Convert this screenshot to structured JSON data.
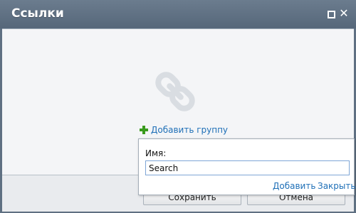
{
  "window": {
    "title": "Ссылки",
    "maximize_icon": "maximize-icon",
    "close_icon": "close-icon"
  },
  "main": {
    "empty_icon": "chain-link-icon",
    "add_group_icon": "plus-icon",
    "add_group_label": "Добавить группу"
  },
  "popup": {
    "name_label": "Имя:",
    "name_value": "Search",
    "add_label": "Добавить",
    "close_label": "Закрыть"
  },
  "footer": {
    "save_label": "Сохранить",
    "cancel_label": "Отмена"
  },
  "colors": {
    "titlebar": "#5f7082",
    "link": "#1e6fb7",
    "plus": "#3a9b1e",
    "content_bg": "#f4f5f7"
  }
}
